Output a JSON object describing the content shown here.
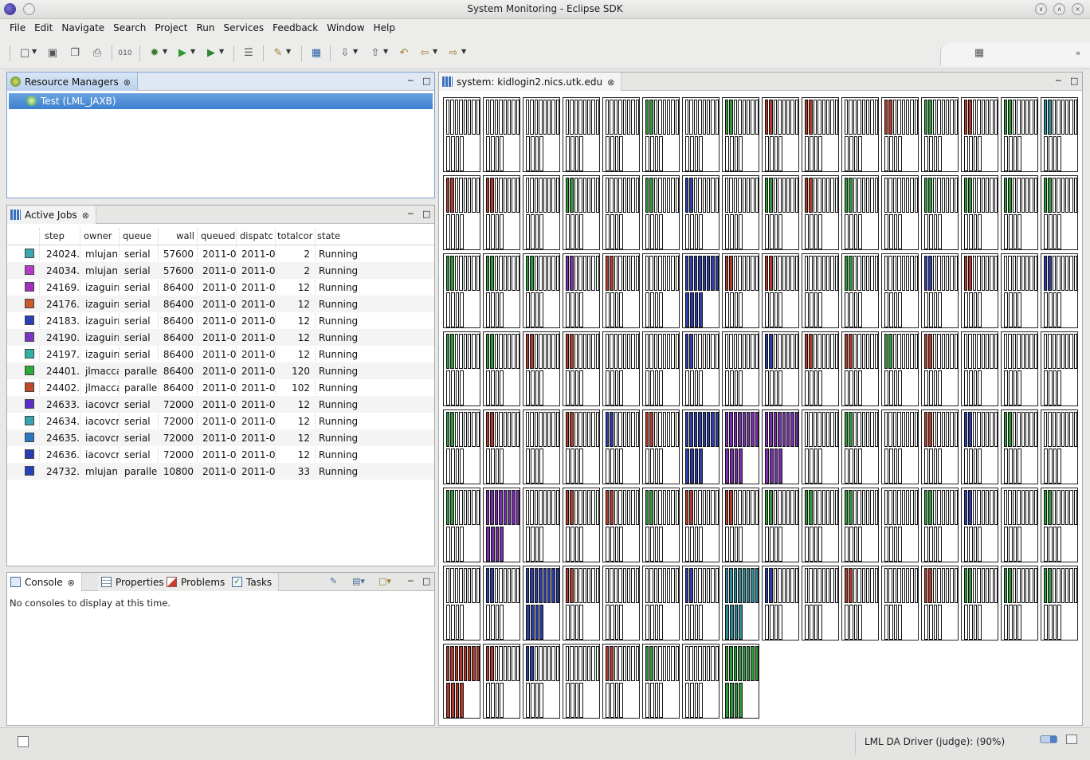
{
  "window": {
    "title": "System Monitoring - Eclipse SDK"
  },
  "menu": [
    "File",
    "Edit",
    "Navigate",
    "Search",
    "Project",
    "Run",
    "Services",
    "Feedback",
    "Window",
    "Help"
  ],
  "resource_managers": {
    "tab": "Resource Managers",
    "item": "Test (LML_JAXB)"
  },
  "active_jobs": {
    "tab": "Active Jobs",
    "columns": [
      "step",
      "owner",
      "queue",
      "wall",
      "queued",
      "dispatc",
      "totalcor",
      "state"
    ],
    "rows": [
      {
        "color": "#3aa7b0",
        "step": "24024.",
        "owner": "mlujan",
        "queue": "serial",
        "wall": "57600",
        "queued": "2011-0",
        "dispatch": "2011-0",
        "totalcores": "2",
        "state": "Running"
      },
      {
        "color": "#b63cc4",
        "step": "24034.",
        "owner": "mlujan",
        "queue": "serial",
        "wall": "57600",
        "queued": "2011-0",
        "dispatch": "2011-0",
        "totalcores": "2",
        "state": "Running"
      },
      {
        "color": "#a22ec0",
        "step": "24169.",
        "owner": "izaguirr",
        "queue": "serial",
        "wall": "86400",
        "queued": "2011-0",
        "dispatch": "2011-0",
        "totalcores": "12",
        "state": "Running"
      },
      {
        "color": "#c85a2e",
        "step": "24176.",
        "owner": "izaguirr",
        "queue": "serial",
        "wall": "86400",
        "queued": "2011-0",
        "dispatch": "2011-0",
        "totalcores": "12",
        "state": "Running"
      },
      {
        "color": "#2a3fb8",
        "step": "24183.",
        "owner": "izaguirr",
        "queue": "serial",
        "wall": "86400",
        "queued": "2011-0",
        "dispatch": "2011-0",
        "totalcores": "12",
        "state": "Running"
      },
      {
        "color": "#7a34c6",
        "step": "24190.",
        "owner": "izaguirr",
        "queue": "serial",
        "wall": "86400",
        "queued": "2011-0",
        "dispatch": "2011-0",
        "totalcores": "12",
        "state": "Running"
      },
      {
        "color": "#33b0a6",
        "step": "24197.",
        "owner": "izaguirr",
        "queue": "serial",
        "wall": "86400",
        "queued": "2011-0",
        "dispatch": "2011-0",
        "totalcores": "12",
        "state": "Running"
      },
      {
        "color": "#2eaa36",
        "step": "24401.",
        "owner": "jlmacca",
        "queue": "parallel",
        "wall": "86400",
        "queued": "2011-0",
        "dispatch": "2011-0",
        "totalcores": "120",
        "state": "Running"
      },
      {
        "color": "#c0482a",
        "step": "24402.",
        "owner": "jlmacca",
        "queue": "parallel",
        "wall": "86400",
        "queued": "2011-0",
        "dispatch": "2011-0",
        "totalcores": "102",
        "state": "Running"
      },
      {
        "color": "#5a2ec6",
        "step": "24633.",
        "owner": "iacovcr",
        "queue": "serial",
        "wall": "72000",
        "queued": "2011-0",
        "dispatch": "2011-0",
        "totalcores": "12",
        "state": "Running"
      },
      {
        "color": "#34a4ae",
        "step": "24634.",
        "owner": "iacovcr",
        "queue": "serial",
        "wall": "72000",
        "queued": "2011-0",
        "dispatch": "2011-0",
        "totalcores": "12",
        "state": "Running"
      },
      {
        "color": "#2d76c0",
        "step": "24635.",
        "owner": "iacovcr",
        "queue": "serial",
        "wall": "72000",
        "queued": "2011-0",
        "dispatch": "2011-0",
        "totalcores": "12",
        "state": "Running"
      },
      {
        "color": "#2a3cb4",
        "step": "24636.",
        "owner": "iacovcr",
        "queue": "serial",
        "wall": "72000",
        "queued": "2011-0",
        "dispatch": "2011-0",
        "totalcores": "12",
        "state": "Running"
      },
      {
        "color": "#2640b8",
        "step": "24732.",
        "owner": "mlujan",
        "queue": "parallel",
        "wall": "10800",
        "queued": "2011-0",
        "dispatch": "2011-0",
        "totalcores": "33",
        "state": "Running"
      }
    ]
  },
  "console": {
    "tabs": [
      "Console",
      "Properties",
      "Problems",
      "Tasks"
    ],
    "message": "No consoles to display at this time."
  },
  "system_view": {
    "tab": "system: kidlogin2.nics.utk.edu",
    "node_colors": {
      "r": "#b23a2a",
      "g": "#2f9a3a",
      "b": "#2c3ea8",
      "p": "#7a2fb0",
      "t": "#2f8a9a",
      "w": "#ffffff"
    },
    "nodes": [
      "w",
      "w",
      "w",
      "w",
      "w",
      "g",
      "w",
      "g",
      "r",
      "r",
      "w",
      "r",
      "g",
      "r",
      "g",
      "t",
      "r",
      "r",
      "w",
      "g",
      "w",
      "g",
      "b",
      "w",
      "g",
      "r",
      "g",
      "w",
      "g",
      "g",
      "g",
      "g",
      "g",
      "g",
      "g",
      "p",
      "r",
      "w",
      "B",
      "r",
      "r",
      "w",
      "g",
      "w",
      "b",
      "r",
      "w",
      "b",
      "g",
      "g",
      "r",
      "r",
      "w",
      "w",
      "b",
      "w",
      "b",
      "r",
      "r",
      "g",
      "r",
      "w",
      "w",
      "w",
      "g",
      "r",
      "w",
      "r",
      "b",
      "r",
      "B",
      "P",
      "P",
      "w",
      "g",
      "w",
      "r",
      "b",
      "g",
      "w",
      "g",
      "P",
      "w",
      "r",
      "r",
      "g",
      "r",
      "r",
      "g",
      "g",
      "g",
      "w",
      "g",
      "b",
      "w",
      "g",
      "w",
      "b",
      "B",
      "r",
      "w",
      "w",
      "b",
      "T",
      "b",
      "w",
      "r",
      "w",
      "r",
      "g",
      "g",
      "g",
      "R",
      "r",
      "b",
      "w",
      "r",
      "g",
      "w",
      "G"
    ]
  },
  "status": {
    "text": "LML DA Driver (judge): (90%)"
  }
}
